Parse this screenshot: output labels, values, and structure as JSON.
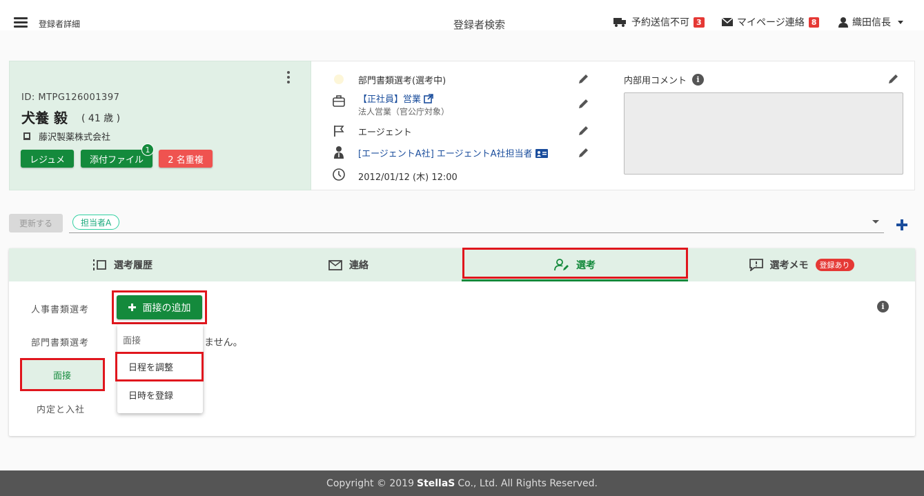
{
  "header": {
    "breadcrumb": "登録者詳細",
    "center_title": "登録者検索",
    "reservation_label": "予約送信不可",
    "reservation_count": "3",
    "mypage_label": "マイページ連絡",
    "mypage_count": "8",
    "user_name": "織田信長"
  },
  "profile": {
    "id": "ID: MTPG126001397",
    "name": "犬養 毅",
    "age": "( 41 歳 )",
    "company": "藤沢製薬株式会社",
    "buttons": {
      "resume": "レジュメ",
      "attachments": "添付ファイル",
      "attachments_count": "1",
      "duplicates": "2 名重複"
    }
  },
  "details": {
    "status": "部門書類選考(選考中)",
    "job_title": "【正社員】営業",
    "job_sub": "法人営業（官公庁対象）",
    "channel": "エージェント",
    "agent": "[エージェントA社] エージェントA社担当者",
    "datetime": "2012/01/12 (木) 12:00"
  },
  "comment": {
    "label": "内部用コメント"
  },
  "assign": {
    "update_label": "更新する",
    "assignee_chip": "担当者A"
  },
  "tabs": {
    "history": "選考履歴",
    "contact": "連絡",
    "selection": "選考",
    "memo": "選考メモ",
    "memo_badge": "登録あり"
  },
  "stages": {
    "hr_docs": "人事書類選考",
    "dept_docs": "部門書類選考",
    "interview": "面接",
    "offer": "内定と入社"
  },
  "selection": {
    "add_interview": "面接の追加",
    "empty_text": "ません。"
  },
  "menu": {
    "header": "面接",
    "adjust": "日程を調整",
    "register": "日時を登録"
  },
  "footer": {
    "prefix": "Copyright © 2019",
    "brand": "StellaS",
    "suffix": "Co., Ltd. All Rights Reserved."
  }
}
